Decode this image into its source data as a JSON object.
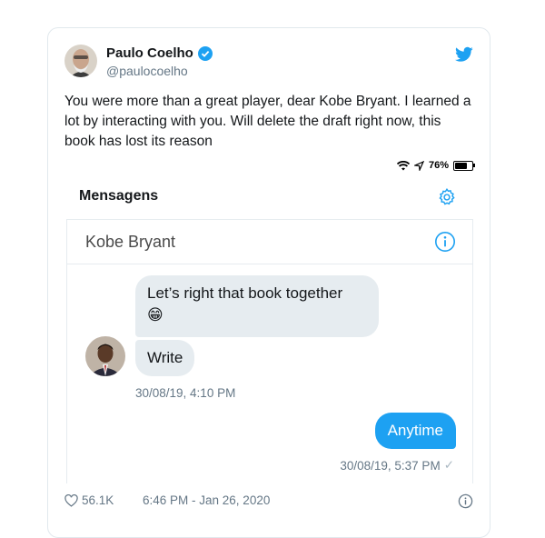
{
  "tweet": {
    "author_name": "Paulo Coelho",
    "author_handle": "@paulocoelho",
    "text": "You were more than a great player, dear Kobe Bryant. I learned a lot by interacting with you. Will delete the draft right now, this book has lost its reason",
    "likes": "56.1K",
    "timestamp": "6:46 PM - Jan 26, 2020"
  },
  "screenshot": {
    "status_battery": "76%",
    "title": "Mensagens",
    "conversation_name": "Kobe Bryant",
    "messages_in": [
      "Let’s right that book together",
      "Write"
    ],
    "emoji": "😁",
    "time_in": "30/08/19, 4:10 PM",
    "message_out": "Anytime",
    "time_out": "30/08/19, 5:37 PM",
    "read_mark": "✓"
  },
  "colors": {
    "brand": "#1da1f2",
    "bubble_in": "#e6ecf0",
    "secondary_text": "#657786"
  },
  "icons": [
    "verified-icon",
    "twitter-bird-icon",
    "wifi-icon",
    "location-arrow-icon",
    "battery-icon",
    "gear-icon",
    "info-icon",
    "heart-icon"
  ]
}
